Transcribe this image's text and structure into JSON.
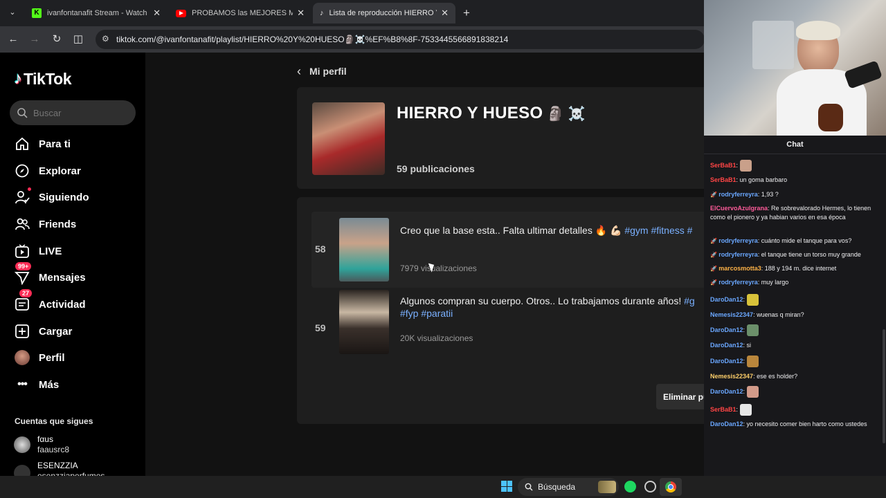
{
  "browser": {
    "tabs": [
      {
        "title": "ivanfontanafit Stream - Watch Live"
      },
      {
        "title": "PROBAMOS las MEJORES MÁQUINAS"
      },
      {
        "title": "Lista de reproducción HIERRO Y HUESO"
      }
    ],
    "url": "tiktok.com/@ivanfontanafit/playlist/HIERRO%20Y%20HUESO🗿☠️%EF%B8%8F-7533445566891838214"
  },
  "tiktok": {
    "logo": "TikTok",
    "search_placeholder": "Buscar",
    "nav": [
      {
        "label": "Para ti",
        "icon": "home-icon"
      },
      {
        "label": "Explorar",
        "icon": "compass-icon"
      },
      {
        "label": "Siguiendo",
        "icon": "following-icon"
      },
      {
        "label": "Friends",
        "icon": "friends-icon"
      },
      {
        "label": "LIVE",
        "icon": "live-icon"
      },
      {
        "label": "Mensajes",
        "icon": "messages-icon",
        "badge": "99+"
      },
      {
        "label": "Actividad",
        "icon": "activity-icon",
        "badge": "27"
      },
      {
        "label": "Cargar",
        "icon": "upload-icon"
      },
      {
        "label": "Perfil",
        "icon": "avatar-icon"
      },
      {
        "label": "Más",
        "icon": "more-icon"
      }
    ],
    "following_header": "Cuentas que sigues",
    "following": [
      {
        "name": "fαus",
        "handle": "faausrc8"
      },
      {
        "name": "ESENZZIA",
        "handle": "esenzziaperfumes"
      }
    ]
  },
  "playlist": {
    "back_label": "Mi perfil",
    "title": "HIERRO Y HUESO",
    "title_emoji": "🗿 ☠️",
    "count": "59 publicaciones",
    "items": [
      {
        "index": "58",
        "desc": "Creo que la base esta.. Falta ultimar detalles 🔥 💪🏻 ",
        "tags": "#gym #fitness #",
        "tags2": "",
        "views": "7979 visualizaciones"
      },
      {
        "index": "59",
        "desc": "Algunos compran su cuerpo. Otros.. Lo trabajamos durante años! ",
        "tags": "#g",
        "tags2": "#fyp #paratii",
        "views": "20K visualizaciones"
      }
    ],
    "remove_button": "Eliminar pu"
  },
  "chat": {
    "header": "Chat",
    "messages": [
      {
        "user": "SerBaB1",
        "text": "",
        "color": "#ff4545",
        "emote": "#c9a08a"
      },
      {
        "user": "SerBaB1",
        "text": "un goma barbaro",
        "color": "#ff4545"
      },
      {
        "user": "rodryferreyra",
        "text": "1,93 ?",
        "color": "#6aa7ff",
        "badge": true
      },
      {
        "user": "ElCuervoAzulgrana",
        "text": "Re sobrevalorado Hermes, lo tienen como el pionero y ya habian varios en esa época",
        "color": "#ff5b9a"
      },
      {
        "user": "rodryferreyra",
        "text": "cuánto mide el tanque para vos?",
        "color": "#6aa7ff",
        "badge": true
      },
      {
        "user": "rodryferreyra",
        "text": "el tanque tiene un torso muy grande",
        "color": "#6aa7ff",
        "badge": true
      },
      {
        "user": "marcosmotta3",
        "text": "188 y 194 m. dice internet",
        "color": "#ffb347",
        "badge": true
      },
      {
        "user": "rodryferreyra",
        "text": "muy largo",
        "color": "#6aa7ff",
        "badge": true
      },
      {
        "user": "DaroDan12",
        "text": "",
        "color": "#6aa7ff",
        "emote": "#d8c23a"
      },
      {
        "user": "Nemesis22347",
        "text": "wuenas q miran?",
        "color": "#6aa7ff"
      },
      {
        "user": "DaroDan12",
        "text": "",
        "color": "#6aa7ff",
        "emote": "#6b8f6a"
      },
      {
        "user": "DaroDan12",
        "text": "si",
        "color": "#6aa7ff"
      },
      {
        "user": "DaroDan12",
        "text": "",
        "color": "#6aa7ff",
        "emote": "#b9863c"
      },
      {
        "user": "Nemesis22347",
        "text": "ese es holder?",
        "color": "#ffcf6a"
      },
      {
        "user": "DaroDan12",
        "text": "",
        "color": "#6aa7ff",
        "emote": "#d39b8a"
      },
      {
        "user": "SerBaB1",
        "text": "",
        "color": "#ff4545",
        "emote": "#e6e6e6"
      },
      {
        "user": "DaroDan12",
        "text": "yo necesito comer bien harto como ustedes",
        "color": "#6aa7ff"
      }
    ]
  },
  "taskbar": {
    "search_label": "Búsqueda"
  }
}
